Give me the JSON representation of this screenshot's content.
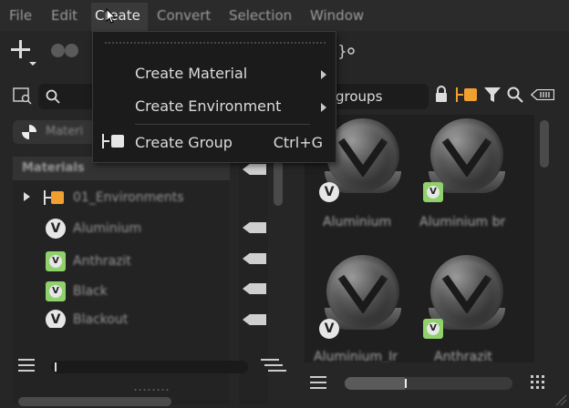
{
  "menubar": {
    "items": [
      "File",
      "Edit",
      "Create",
      "Convert",
      "Selection",
      "Window"
    ],
    "active": "Create"
  },
  "dropdown": {
    "items": [
      {
        "label": "Create Material",
        "submenu": true
      },
      {
        "label": "Create Environment",
        "submenu": true
      },
      {
        "label": "Create Group",
        "shortcut": "Ctrl+G"
      }
    ]
  },
  "left_panel": {
    "search_placeholder": "",
    "filter_chip": "Materi",
    "header": "Materials",
    "tree": [
      {
        "label": "01_Environments",
        "type": "group"
      },
      {
        "label": "Aluminium",
        "type": "material"
      },
      {
        "label": "Anthrazit",
        "type": "material-green"
      },
      {
        "label": "Black",
        "type": "material-green"
      },
      {
        "label": "Blackout",
        "type": "material"
      }
    ]
  },
  "right_panel": {
    "search_value": "groups",
    "thumbnails": [
      {
        "label": "Aluminium",
        "badge": "round"
      },
      {
        "label": "Aluminium br",
        "badge": "square"
      },
      {
        "label": "Aluminium_Ir",
        "badge": "round"
      },
      {
        "label": "Anthrazit",
        "badge": "square"
      }
    ]
  },
  "colors": {
    "accent_orange": "#f0a030",
    "badge_green": "#8fd16a",
    "menu_bg": "#1b1b1b"
  }
}
